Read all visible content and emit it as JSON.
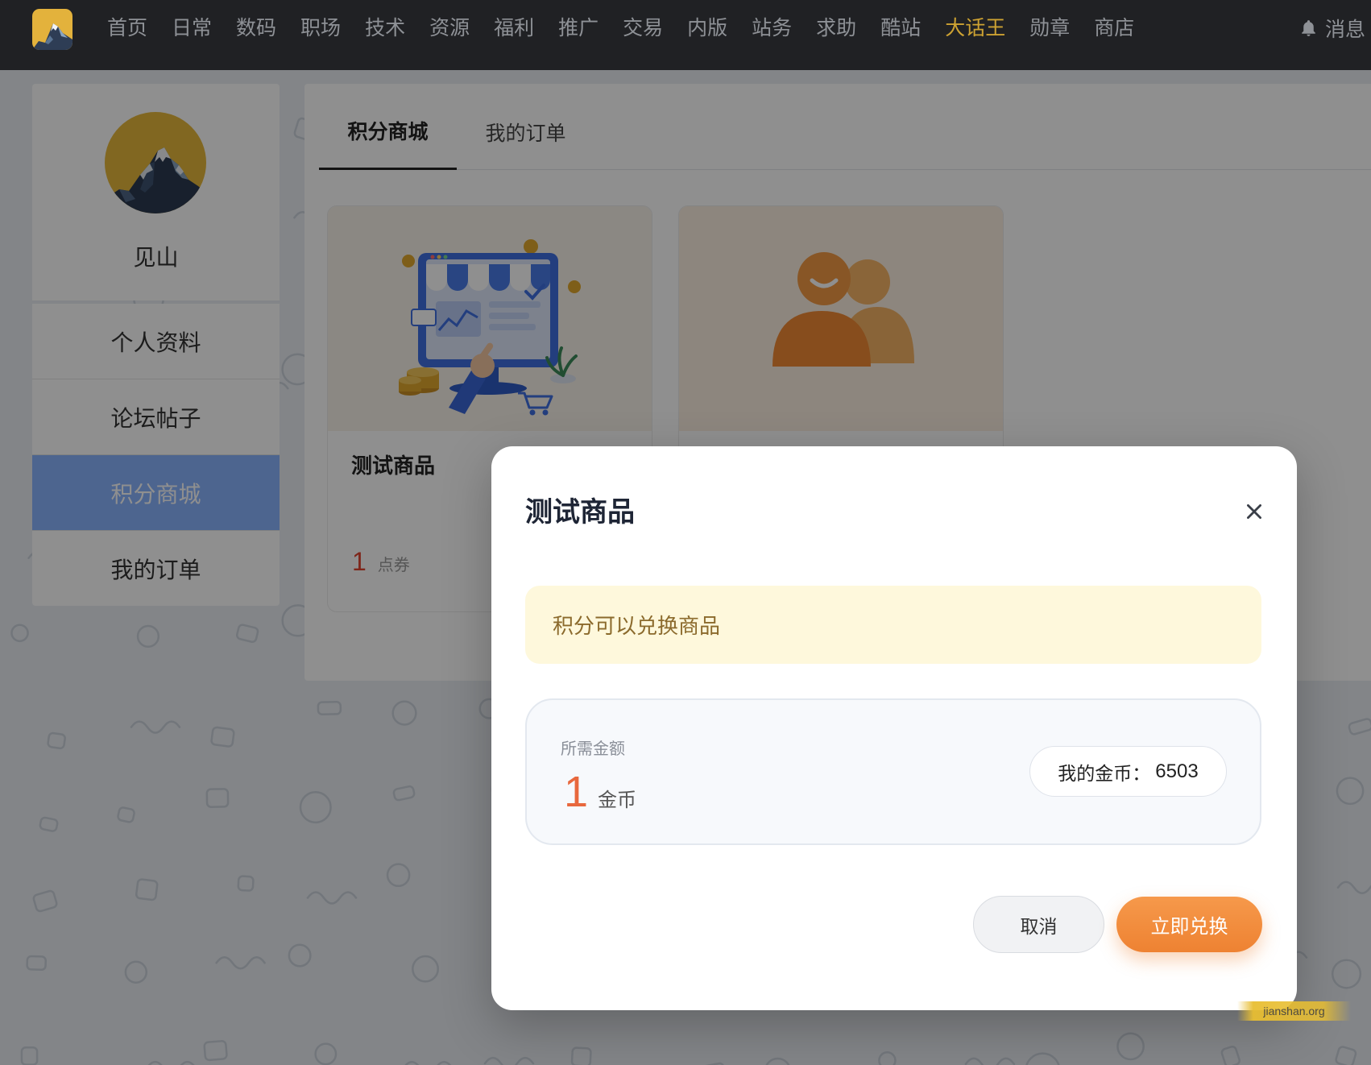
{
  "nav": {
    "items": [
      "首页",
      "日常",
      "数码",
      "职场",
      "技术",
      "资源",
      "福利",
      "推广",
      "交易",
      "内版",
      "站务",
      "求助",
      "酷站",
      "大话王",
      "勋章",
      "商店"
    ],
    "active_item": "大话王",
    "messages_label": "消息",
    "icons": {
      "logo": "mountain-logo",
      "messages": "bell-icon"
    }
  },
  "sidebar": {
    "username": "见山",
    "avatar": "mountain-avatar",
    "menu": [
      "个人资料",
      "论坛帖子",
      "积分商城",
      "我的订单"
    ],
    "active_item": "积分商城"
  },
  "main": {
    "tabs": [
      "积分商城",
      "我的订单"
    ],
    "active_tab": "积分商城",
    "products": [
      {
        "title": "测试商品",
        "price": "1",
        "unit": "点券",
        "image": "shop-illustration"
      },
      {
        "image": "users-icon"
      }
    ]
  },
  "modal": {
    "title": "测试商品",
    "close_icon": "close-icon",
    "notice": "积分可以兑换商品",
    "amount_label": "所需金额",
    "amount_value": "1",
    "amount_unit": "金币",
    "balance_label": "我的金币：",
    "balance_value": "6503",
    "cancel_label": "取消",
    "confirm_label": "立即兑换"
  },
  "watermark": "jianshan.org",
  "colors": {
    "nav_highlight": "#cda232",
    "sidebar_active": "#8ab4ff",
    "amount": "#e8683d",
    "confirm_button": "#ee8232"
  }
}
